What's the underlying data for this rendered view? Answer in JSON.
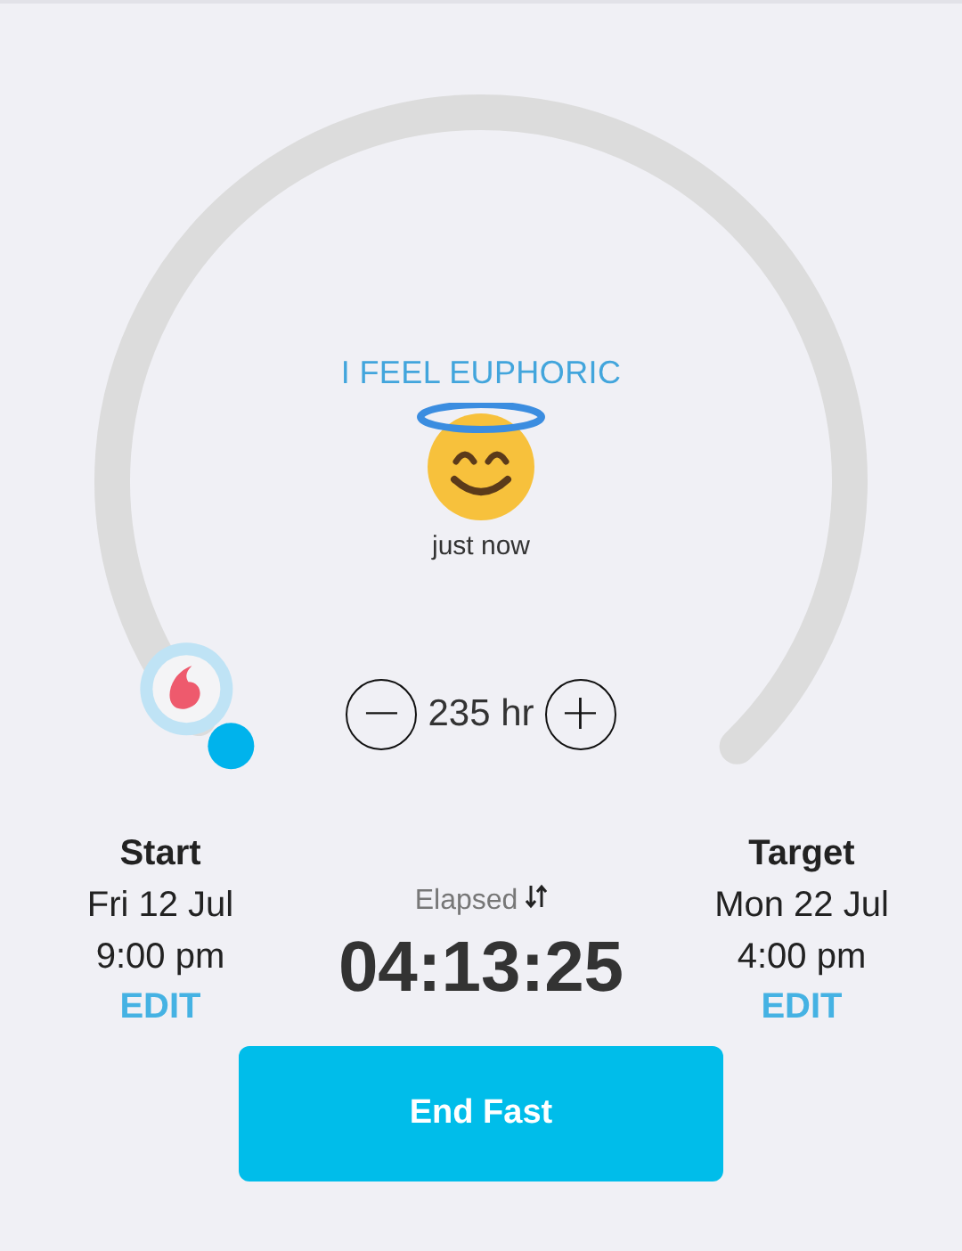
{
  "mood": {
    "label": "I FEEL EUPHORIC",
    "time": "just now"
  },
  "duration": {
    "minus": "−",
    "value": "235 hr",
    "plus": "+"
  },
  "start": {
    "title": "Start",
    "date": "Fri 12 Jul",
    "time": "9:00 pm",
    "action": "EDIT"
  },
  "elapsed": {
    "label": "Elapsed",
    "value": "04:13:25"
  },
  "target": {
    "title": "Target",
    "date": "Mon 22 Jul",
    "time": "4:00 pm",
    "action": "EDIT"
  },
  "button": "End Fast"
}
